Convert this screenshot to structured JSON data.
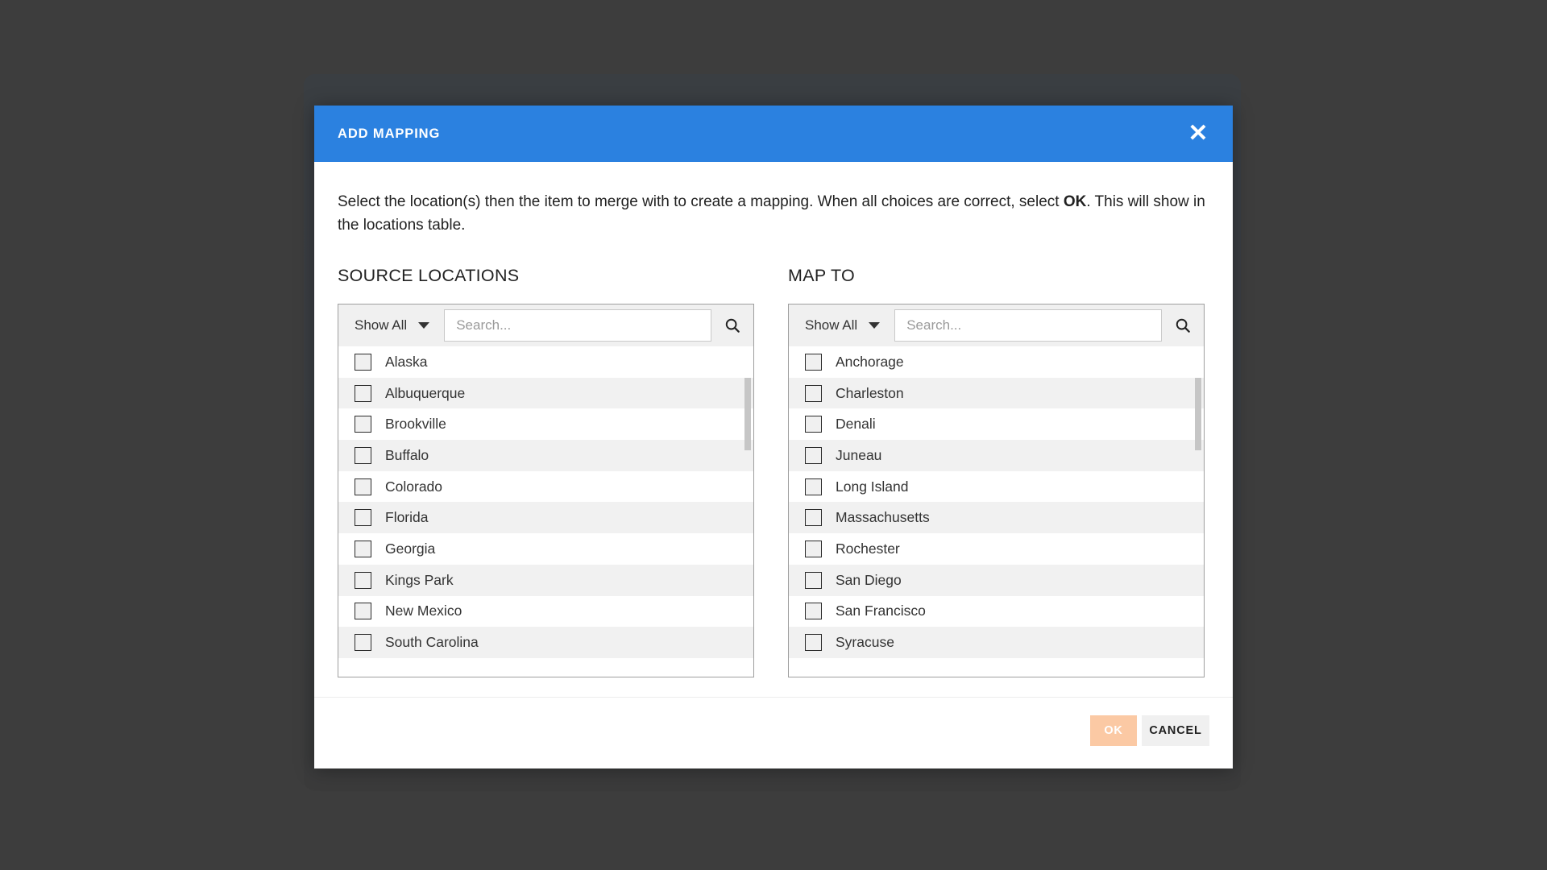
{
  "dialog": {
    "title": "ADD MAPPING",
    "close_icon": "close-icon",
    "intro_before": "Select the location(s) then the item to merge with to create a mapping. When all choices are correct, select ",
    "intro_bold": "OK",
    "intro_after": ". This will show in the locations table.",
    "accent_color": "#2b81e0"
  },
  "source_panel": {
    "heading": "SOURCE LOCATIONS",
    "filter_label": "Show All",
    "filter_icon": "chevron-down-icon",
    "search_placeholder": "Search...",
    "search_value": "",
    "search_icon": "search-icon",
    "items": [
      {
        "label": "Alaska",
        "checked": false
      },
      {
        "label": "Albuquerque",
        "checked": false
      },
      {
        "label": "Brookville",
        "checked": false
      },
      {
        "label": "Buffalo",
        "checked": false
      },
      {
        "label": "Colorado",
        "checked": false
      },
      {
        "label": "Florida",
        "checked": false
      },
      {
        "label": "Georgia",
        "checked": false
      },
      {
        "label": "Kings Park",
        "checked": false
      },
      {
        "label": "New Mexico",
        "checked": false
      },
      {
        "label": "South Carolina",
        "checked": false
      }
    ]
  },
  "target_panel": {
    "heading": "MAP TO",
    "filter_label": "Show All",
    "filter_icon": "chevron-down-icon",
    "search_placeholder": "Search...",
    "search_value": "",
    "search_icon": "search-icon",
    "items": [
      {
        "label": "Anchorage",
        "checked": false
      },
      {
        "label": "Charleston",
        "checked": false
      },
      {
        "label": "Denali",
        "checked": false
      },
      {
        "label": "Juneau",
        "checked": false
      },
      {
        "label": "Long Island",
        "checked": false
      },
      {
        "label": "Massachusetts",
        "checked": false
      },
      {
        "label": "Rochester",
        "checked": false
      },
      {
        "label": "San Diego",
        "checked": false
      },
      {
        "label": "San Francisco",
        "checked": false
      },
      {
        "label": "Syracuse",
        "checked": false
      }
    ]
  },
  "footer": {
    "ok_label": "OK",
    "ok_disabled": true,
    "ok_color": "#fbc9a4",
    "cancel_label": "CANCEL",
    "cancel_color": "#f0f0f0"
  }
}
